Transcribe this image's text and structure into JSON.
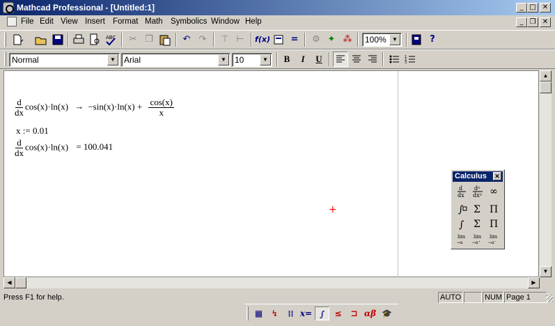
{
  "window": {
    "title": "Mathcad Professional - [Untitled:1]",
    "min": "_",
    "max": "□",
    "close": "✕"
  },
  "doc_controls": {
    "min": "_",
    "restore": "❐",
    "close": "✕"
  },
  "menu": {
    "items": [
      "File",
      "Edit",
      "View",
      "Insert",
      "Format",
      "Math",
      "Symbolics",
      "Window",
      "Help"
    ]
  },
  "toolbar": {
    "zoom": "100%"
  },
  "format_bar": {
    "style": "Normal",
    "font": "Arial",
    "size": "10",
    "bold": "B",
    "italic": "I",
    "underline": "U"
  },
  "worksheet": {
    "eq1": {
      "d": "d",
      "dx": "dx",
      "expr": "cos(x)·ln(x)",
      "arrow": "→",
      "result": "−sin(x)·ln(x) +",
      "cos": "cos(x)",
      "x": "x"
    },
    "eq2": {
      "text": "x := 0.01"
    },
    "eq3": {
      "d": "d",
      "dx": "dx",
      "expr": "cos(x)·ln(x)",
      "result": "= 100.041"
    }
  },
  "cursor": "+",
  "calculus_palette": {
    "title": "Calculus",
    "close": "✕"
  },
  "status": {
    "help": "Press F1 for help.",
    "auto": "AUTO",
    "blank": "",
    "num": "NUM",
    "page": "Page 1"
  },
  "colors": {
    "title_gradient_start": "#0a246a",
    "title_gradient_end": "#a6caf0",
    "chrome": "#d4d0c8",
    "cursor": "#ff0000"
  }
}
